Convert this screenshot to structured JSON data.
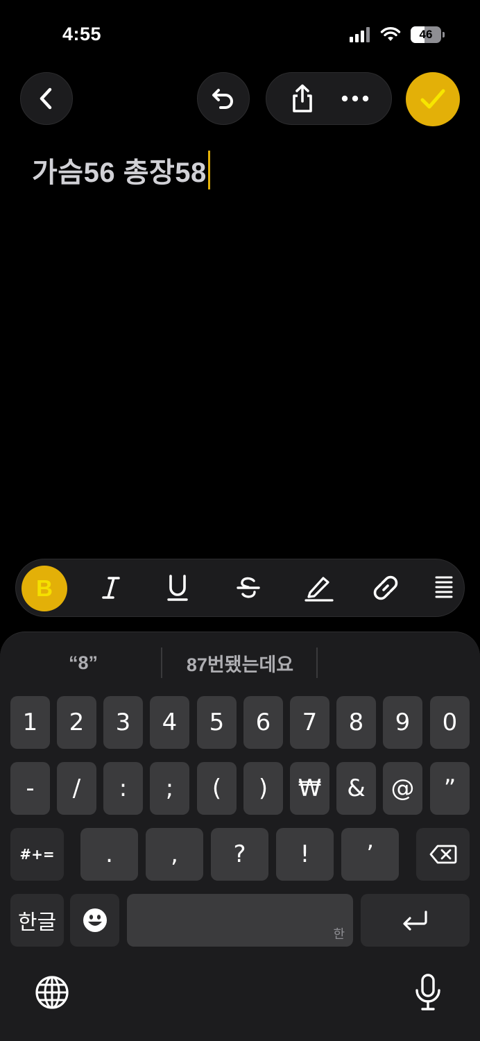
{
  "status_bar": {
    "time": "4:55",
    "battery": "46"
  },
  "note": {
    "text": "가슴56 총장58"
  },
  "suggestions": [
    "“8”",
    "87번됐는데요"
  ],
  "keyboard": {
    "row1": [
      "1",
      "2",
      "3",
      "4",
      "5",
      "6",
      "7",
      "8",
      "9",
      "0"
    ],
    "row2": [
      "-",
      "/",
      ":",
      ";",
      "(",
      ")",
      "₩",
      "&",
      "@",
      "”"
    ],
    "row3": [
      ".",
      ",",
      "?",
      "!",
      "’"
    ],
    "symbols_key": "#+=",
    "lang_key": "한글",
    "space_hint": "한"
  },
  "colors": {
    "accent": "#e3b008",
    "background": "#000000",
    "key": "#3b3b3d"
  }
}
